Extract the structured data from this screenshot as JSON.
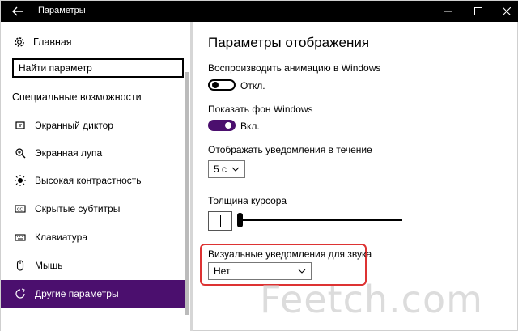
{
  "window": {
    "title": "Параметры"
  },
  "sidebar": {
    "home_label": "Главная",
    "search_placeholder": "Найти параметр",
    "section_title": "Специальные возможности",
    "items": [
      {
        "label": "Экранный диктор",
        "icon": "narrator-icon"
      },
      {
        "label": "Экранная лупа",
        "icon": "magnifier-icon"
      },
      {
        "label": "Высокая контрастность",
        "icon": "contrast-icon"
      },
      {
        "label": "Скрытые субтитры",
        "icon": "captions-icon"
      },
      {
        "label": "Клавиатура",
        "icon": "keyboard-icon"
      },
      {
        "label": "Мышь",
        "icon": "mouse-icon"
      },
      {
        "label": "Другие параметры",
        "icon": "other-options-icon",
        "active": true
      }
    ]
  },
  "main": {
    "title": "Параметры отображения",
    "animation": {
      "label": "Воспроизводить анимацию в Windows",
      "state": "Откл."
    },
    "background": {
      "label": "Показать фон Windows",
      "state": "Вкл."
    },
    "notifications": {
      "label": "Отображать уведомления в течение",
      "value": "5 с"
    },
    "cursor": {
      "label": "Толщина курсора"
    },
    "visual_notifications": {
      "label": "Визуальные уведомления для звука",
      "value": "Нет"
    }
  },
  "watermark": {
    "text": "Feetch.com"
  },
  "colors": {
    "accent": "#4b0f6e",
    "titlebar": "#000000",
    "highlight": "#dd3333"
  }
}
